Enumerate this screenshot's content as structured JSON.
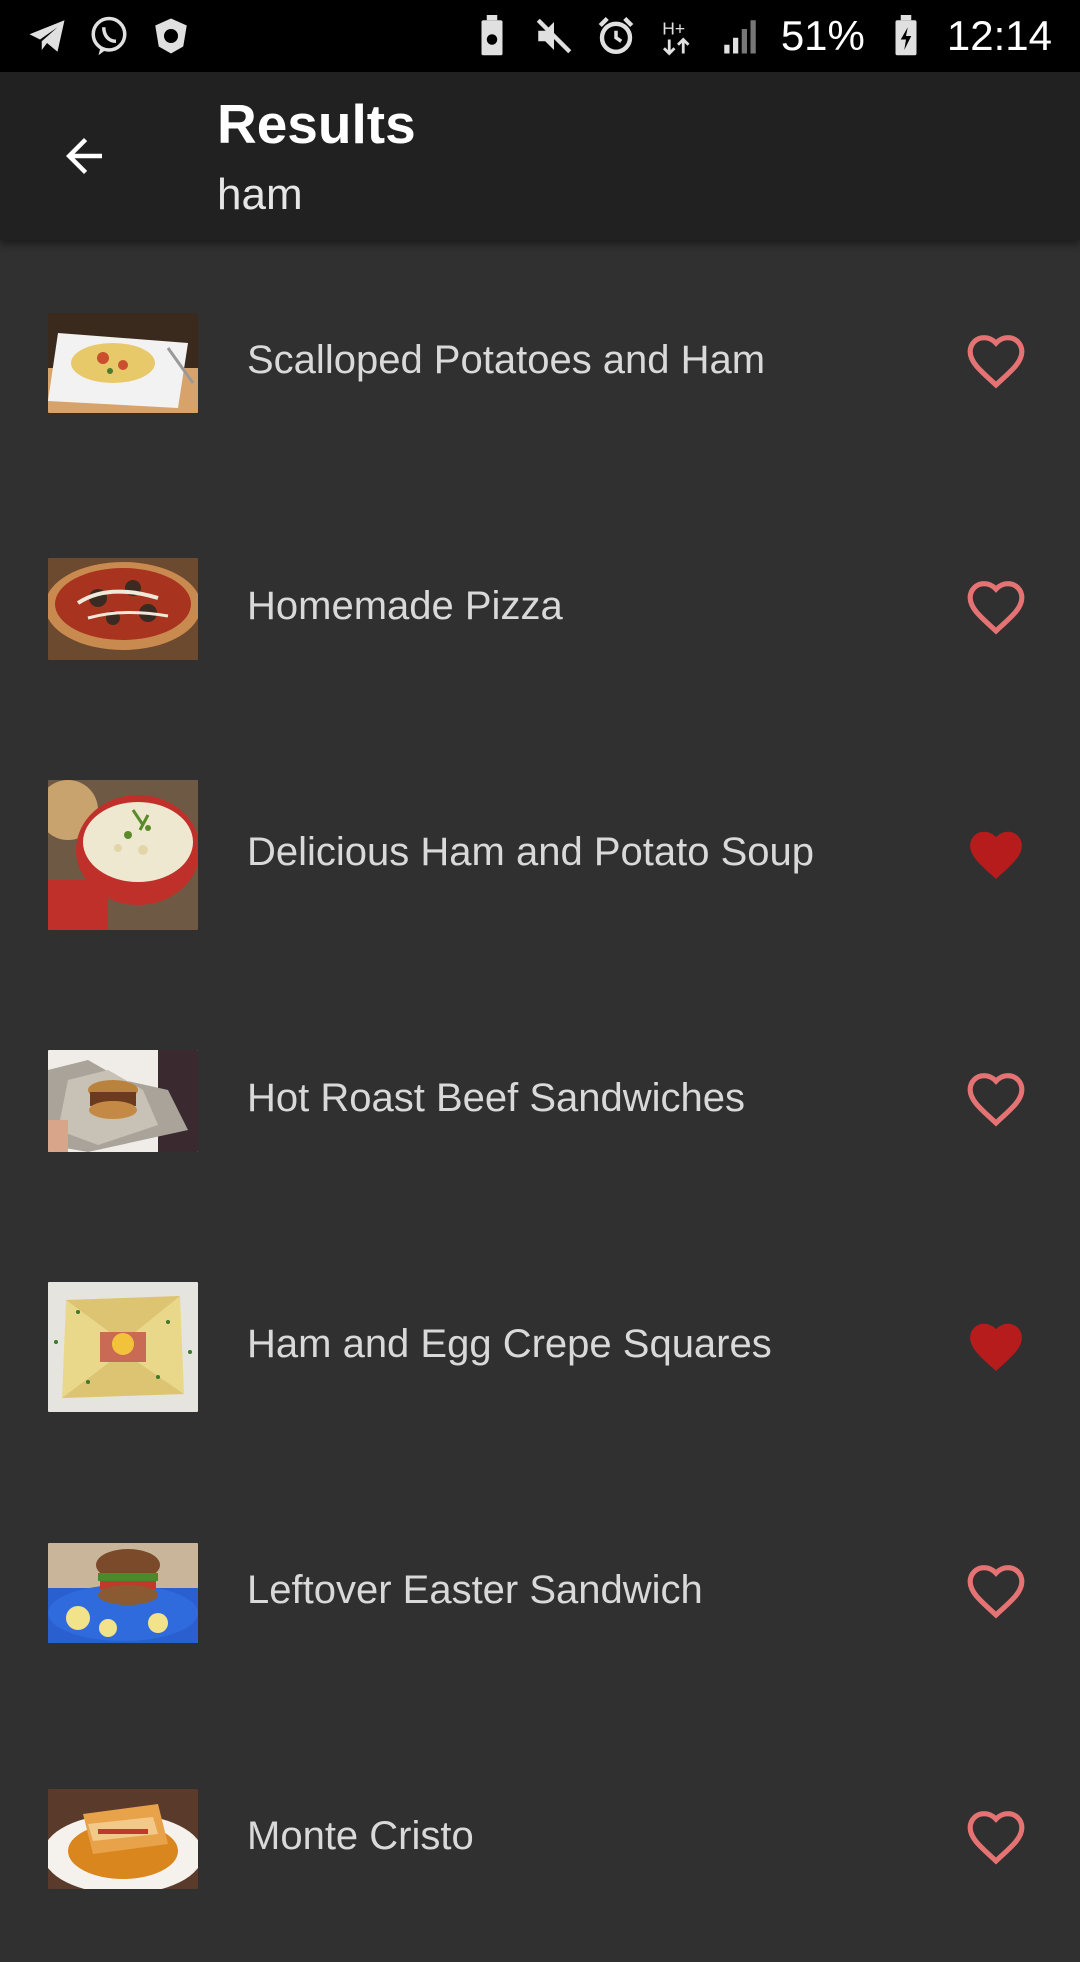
{
  "status_bar": {
    "battery_percent": "51%",
    "time": "12:14",
    "left_icons": [
      "telegram-icon",
      "viber-icon",
      "drweb-icon"
    ],
    "right_icons": [
      "battery-saver-icon",
      "mute-icon",
      "alarm-icon",
      "hplus-data-icon",
      "signal-icon",
      "battery-icon"
    ]
  },
  "app_bar": {
    "title": "Results",
    "subtitle": "ham",
    "back_icon": "arrow-back-icon"
  },
  "colors": {
    "background": "#303030",
    "app_bar": "#212121",
    "favorite_outline": "#e57373",
    "favorite_filled": "#b71c1c"
  },
  "results": [
    {
      "title": "Scalloped Potatoes and Ham",
      "favorite": false
    },
    {
      "title": "Homemade Pizza",
      "favorite": false
    },
    {
      "title": "Delicious Ham and Potato Soup",
      "favorite": true
    },
    {
      "title": "Hot Roast Beef Sandwiches",
      "favorite": false
    },
    {
      "title": "Ham and Egg Crepe Squares",
      "favorite": true
    },
    {
      "title": "Leftover Easter Sandwich",
      "favorite": false
    },
    {
      "title": "Monte Cristo",
      "favorite": false
    }
  ]
}
